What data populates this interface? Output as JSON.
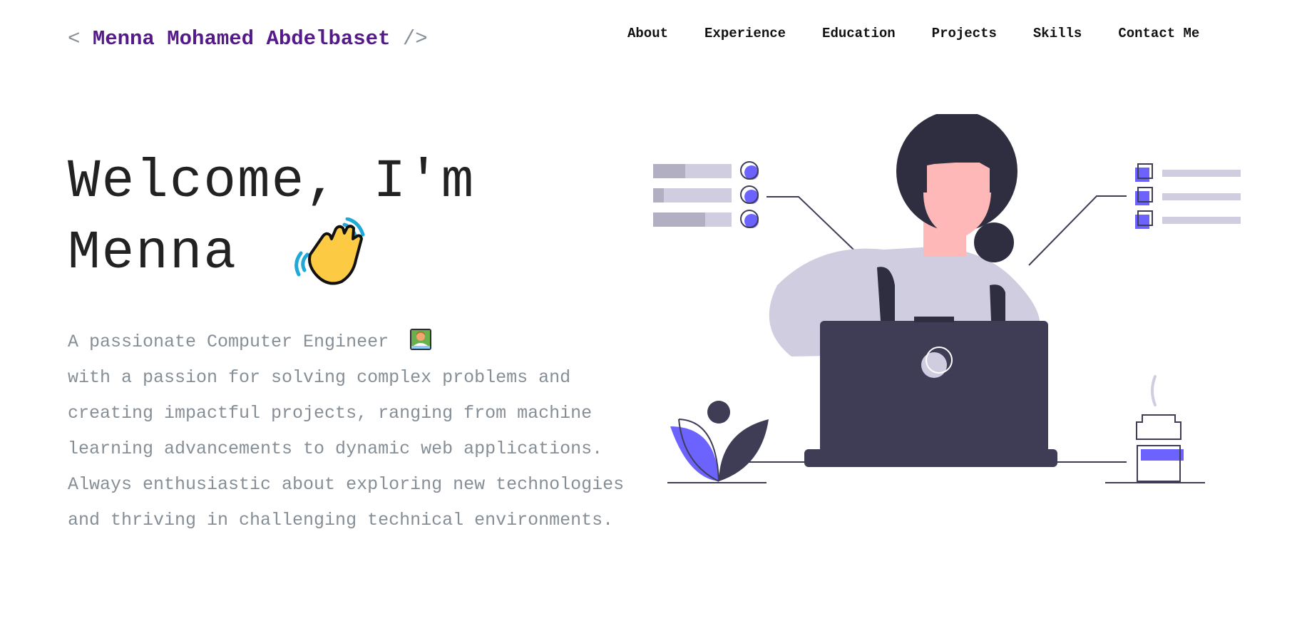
{
  "header": {
    "logo_open": "<",
    "logo_name": "Menna Mohamed Abdelbaset",
    "logo_close": "/>",
    "nav": [
      {
        "label": "About"
      },
      {
        "label": "Experience"
      },
      {
        "label": "Education"
      },
      {
        "label": "Projects"
      },
      {
        "label": "Skills"
      },
      {
        "label": "Contact Me"
      }
    ]
  },
  "hero": {
    "title_line1": "Welcome, I'm",
    "title_line2": "Menna",
    "wave_emoji": "waving-hand-icon",
    "subtitle_line1": "A passionate Computer Engineer",
    "tech_emoji": "technologist-icon",
    "description": "with a passion for solving complex problems and creating impactful projects, ranging from machine learning advancements to dynamic web applications. Always enthusiastic about exploring new technologies and thriving in challenging technical environments."
  },
  "colors": {
    "brand": "#55198b",
    "muted_text": "#868e96",
    "accent": "#6c63ff",
    "dark": "#3f3d56"
  }
}
